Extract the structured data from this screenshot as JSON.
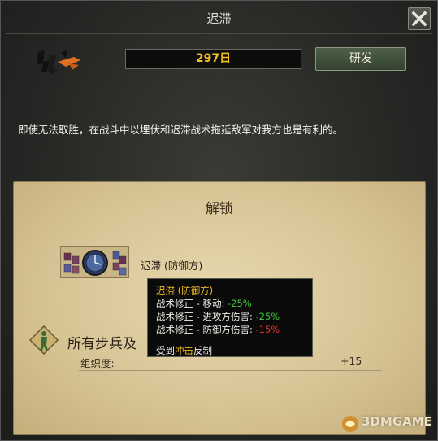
{
  "window": {
    "title": "迟滞",
    "days_value": "297",
    "days_unit": "日",
    "research_label": "研发",
    "description": "即使无法取胜，在战斗中以埋伏和迟滞战术拖延敌军对我方也是有利的。"
  },
  "unlock": {
    "heading": "解锁",
    "tactic_label": "迟滞 (防御方)",
    "infantry_text": "所有步兵及",
    "org_label": "组织度:",
    "org_value": "+15"
  },
  "tooltip": {
    "title": "迟滞 (防御方)",
    "lines": [
      {
        "label": "战术修正 - 移动: ",
        "value": "-25%"
      },
      {
        "label": "战术修正 - 进攻方伤害: ",
        "value": "-25%"
      },
      {
        "label": "战术修正 - 防御方伤害: ",
        "value": "-15%"
      }
    ],
    "counter_prefix": "受到",
    "counter_highlight": "冲击",
    "counter_suffix": "反制"
  },
  "watermark": "3DMGAME",
  "colors": {
    "days": "#f0c020",
    "tooltip_title": "#f0b820",
    "negative_good": "#3cc63c",
    "negative_bad": "#e03030"
  }
}
